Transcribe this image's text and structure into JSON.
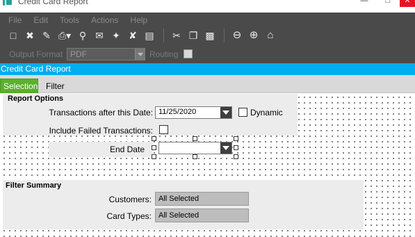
{
  "window": {
    "title": "Credit Card Report"
  },
  "menu": [
    "File",
    "Edit",
    "Tools",
    "Actions",
    "Help"
  ],
  "toolbar": {
    "output_format_label": "Output Format",
    "output_format_value": "PDF",
    "routing_label": "Routing"
  },
  "header": {
    "title": "Credit Card Report"
  },
  "tabs": [
    {
      "label": "Selection",
      "active": true
    },
    {
      "label": "Filter",
      "active": false
    }
  ],
  "report_options": {
    "title": "Report Options",
    "transactions_after_label": "Transactions after this Date:",
    "transactions_after_value": "11/25/2020",
    "dynamic_label": "Dynamic",
    "include_failed_label": "Include Failed Transactions:",
    "end_date_label": "End Date",
    "end_date_value": ""
  },
  "filter_summary": {
    "title": "Filter Summary",
    "customers_label": "Customers:",
    "customers_value": "All Selected",
    "card_types_label": "Card Types:",
    "card_types_value": "All Selected"
  },
  "colors": {
    "header_blue": "#00adef",
    "active_tab_green": "#5ab02e",
    "toolbar_dark": "#4a4a4a"
  }
}
